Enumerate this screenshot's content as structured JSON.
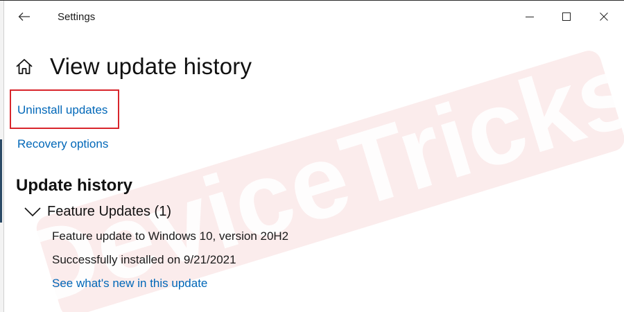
{
  "window": {
    "app_title": "Settings"
  },
  "page": {
    "title": "View update history"
  },
  "links": {
    "uninstall": "Uninstall updates",
    "recovery": "Recovery options"
  },
  "history": {
    "section_title": "Update history",
    "group_label": "Feature Updates (1)",
    "items": [
      {
        "name": "Feature update to Windows 10, version 20H2",
        "status": "Successfully installed on 9/21/2021",
        "link": "See what's new in this update"
      }
    ]
  },
  "watermark": {
    "text": "DeviceTricks"
  },
  "colors": {
    "link": "#0067b8",
    "highlight": "#d8252b",
    "watermark": "#f6d3d3"
  }
}
